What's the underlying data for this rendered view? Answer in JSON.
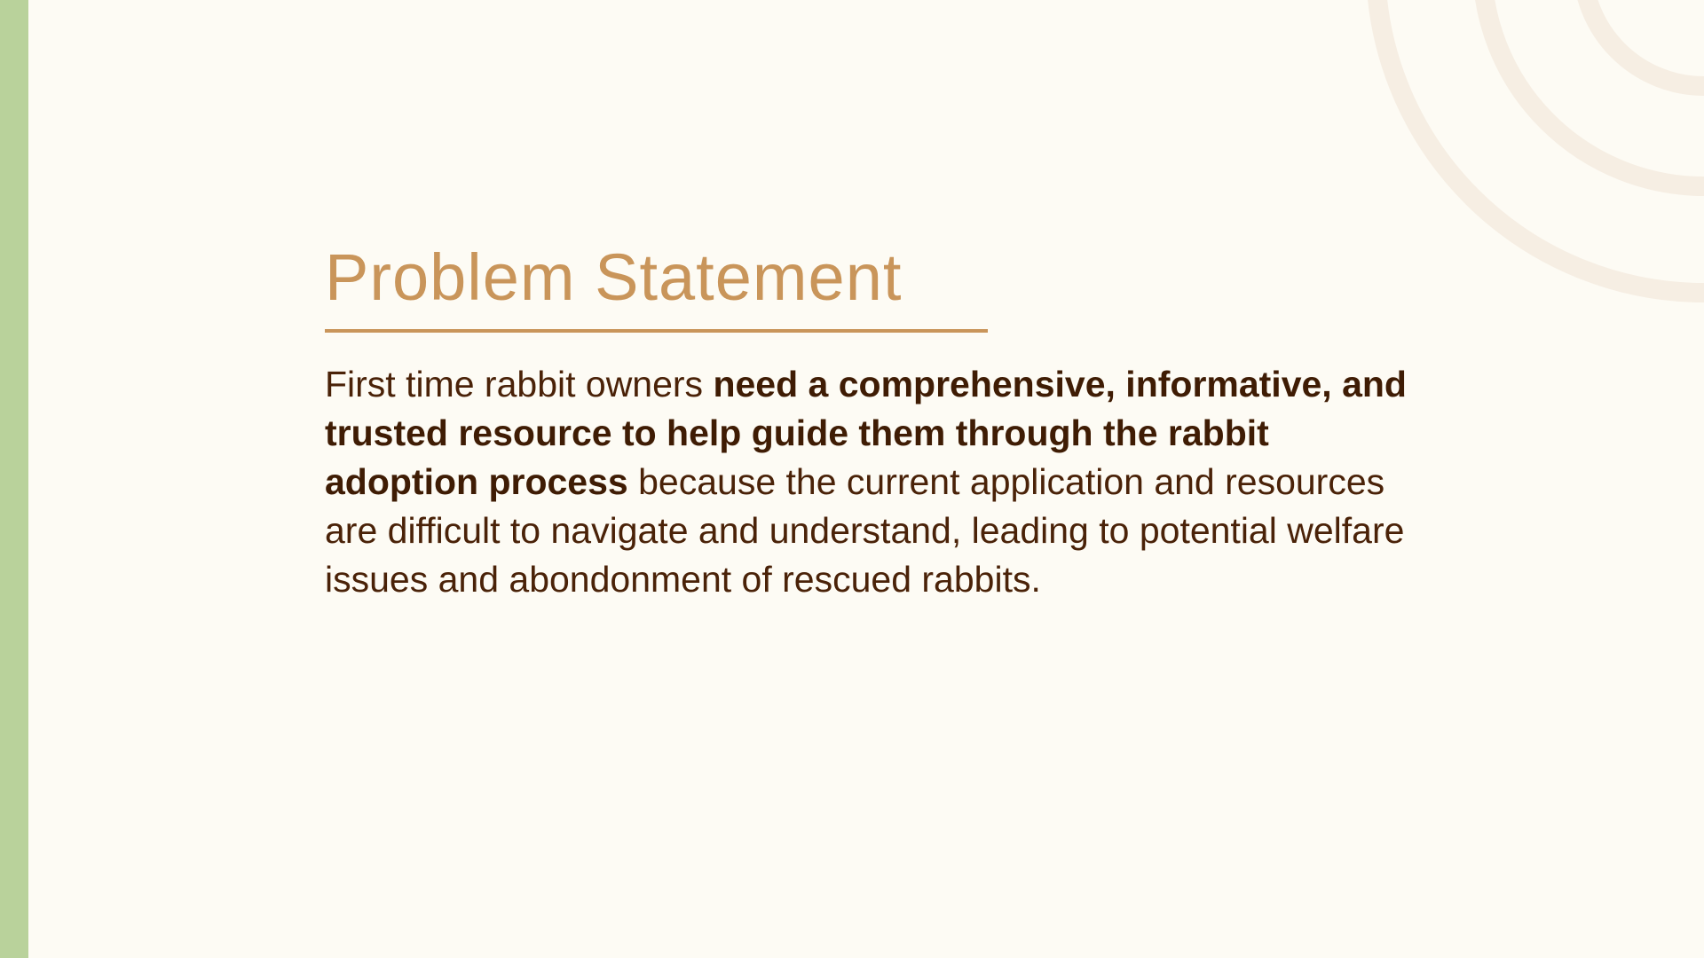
{
  "slide": {
    "title": "Problem Statement",
    "body": {
      "intro": "First time rabbit owners ",
      "emphasis": "need a comprehensive, informative, and trusted resource to help guide them through the rabbit adoption process",
      "rest": " because the current application and resources are difficult to navigate and understand, leading to potential welfare issues and abondonment of rescued rabbits."
    }
  },
  "colors": {
    "background": "#fdfbf4",
    "left_bar": "#b9d29b",
    "title": "#c9955a",
    "body_text": "#4a2208",
    "decorative_arcs": "#f6eee3"
  }
}
